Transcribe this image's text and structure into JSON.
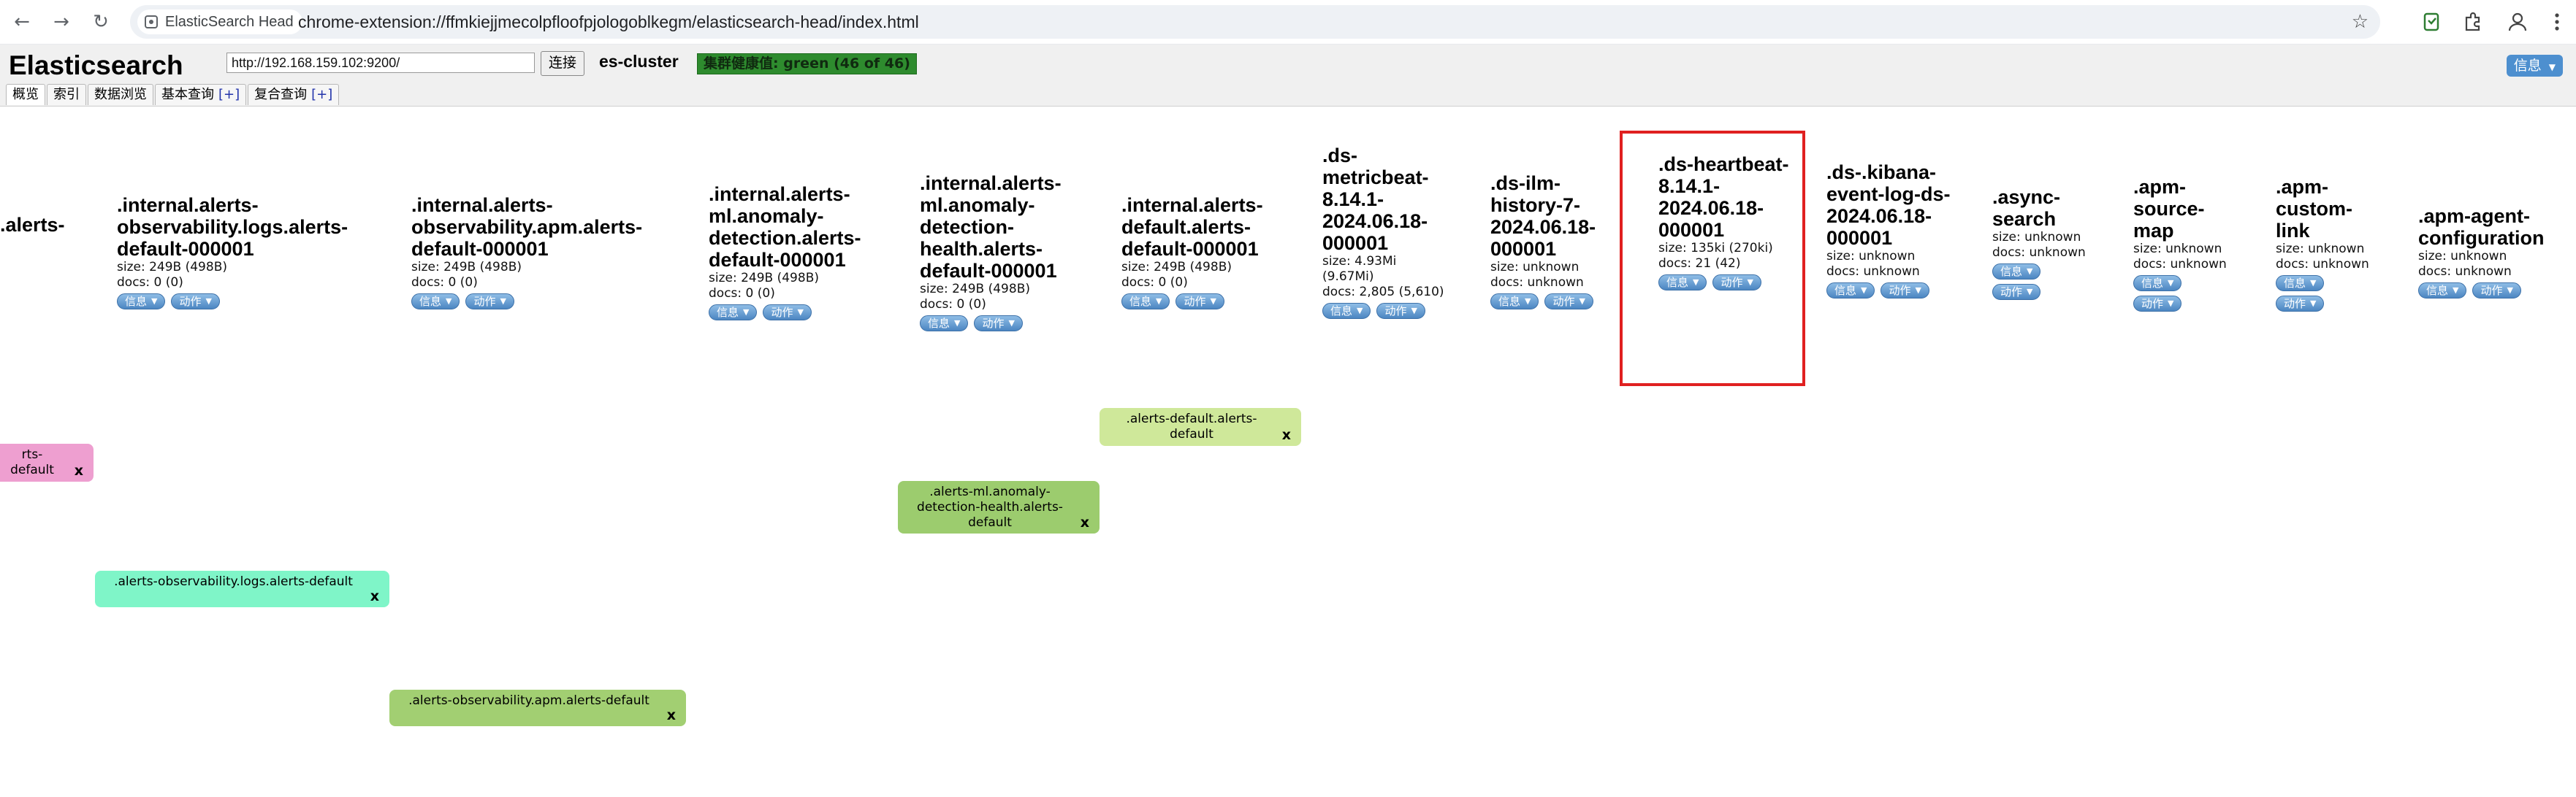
{
  "browser": {
    "tab_chip": "ElasticSearch Head",
    "url": "chrome-extension://ffmkiejjmecolpfloofpjologoblkegm/elasticsearch-head/index.html"
  },
  "header": {
    "title": "Elasticsearch",
    "cluster_url": "http://192.168.159.102:9200/",
    "connect_label": "连接",
    "cluster_name": "es-cluster",
    "health": "集群健康值: green (46 of 46)",
    "info_menu": "信息"
  },
  "tabs": [
    {
      "label": "概览"
    },
    {
      "label": "索引"
    },
    {
      "label": "数据浏览"
    },
    {
      "label": "基本查询",
      "plus": "[+]"
    },
    {
      "label": "复合查询",
      "plus": "[+]"
    }
  ],
  "buttons": {
    "info": "信息",
    "action": "动作"
  },
  "indices": [
    {
      "name": ".alerts-"
    },
    {
      "name": ".internal.alerts-observability.logs.alerts-default-000001",
      "size": "size: 249B (498B)",
      "docs": "docs: 0 (0)"
    },
    {
      "name": ".internal.alerts-observability.apm.alerts-default-000001",
      "size": "size: 249B (498B)",
      "docs": "docs: 0 (0)"
    },
    {
      "name": ".internal.alerts-ml.anomaly-detection.alerts-default-000001",
      "size": "size: 249B (498B)",
      "docs": "docs: 0 (0)"
    },
    {
      "name": ".internal.alerts-ml.anomaly-detection-health.alerts-default-000001",
      "size": "size: 249B (498B)",
      "docs": "docs: 0 (0)"
    },
    {
      "name": ".internal.alerts-default.alerts-default-000001",
      "size": "size: 249B (498B)",
      "docs": "docs: 0 (0)"
    },
    {
      "name": ".ds-metricbeat-8.14.1-2024.06.18-000001",
      "size": "size: 4.93Mi (9.67Mi)",
      "docs": "docs: 2,805 (5,610)"
    },
    {
      "name": ".ds-ilm-history-7-2024.06.18-000001",
      "size": "size: unknown",
      "docs": "docs: unknown"
    },
    {
      "name": ".ds-heartbeat-8.14.1-2024.06.18-000001",
      "size": "size: 135ki (270ki)",
      "docs": "docs: 21 (42)"
    },
    {
      "name": ".ds-.kibana-event-log-ds-2024.06.18-000001",
      "size": "size: unknown",
      "docs": "docs: unknown"
    },
    {
      "name": ".async-search",
      "size": "size: unknown",
      "docs": "docs: unknown"
    },
    {
      "name": ".apm-source-map",
      "size": "size: unknown",
      "docs": "docs: unknown"
    },
    {
      "name": ".apm-custom-link",
      "size": "size: unknown",
      "docs": "docs: unknown"
    },
    {
      "name": ".apm-agent-configuration",
      "size": "size: unknown",
      "docs": "docs: unknown"
    }
  ],
  "aliases": [
    {
      "label": "rts-default",
      "close": "x",
      "color": "#ee9fd0"
    },
    {
      "label": ".alerts-default.alerts-default",
      "close": "x",
      "color": "#cfe89a"
    },
    {
      "label": ".alerts-ml.anomaly-detection-health.alerts-default",
      "close": "x",
      "color": "#9ccc6e"
    },
    {
      "label": ".alerts-observability.logs.alerts-default",
      "close": "x",
      "color": "#7ff5c8"
    },
    {
      "label": ".alerts-observability.apm.alerts-default",
      "close": "x",
      "color": "#a2cf72"
    }
  ],
  "colors": {
    "health_green": "#2e8b2e",
    "highlight": "#e02020",
    "button_blue": "#4c86c2"
  }
}
